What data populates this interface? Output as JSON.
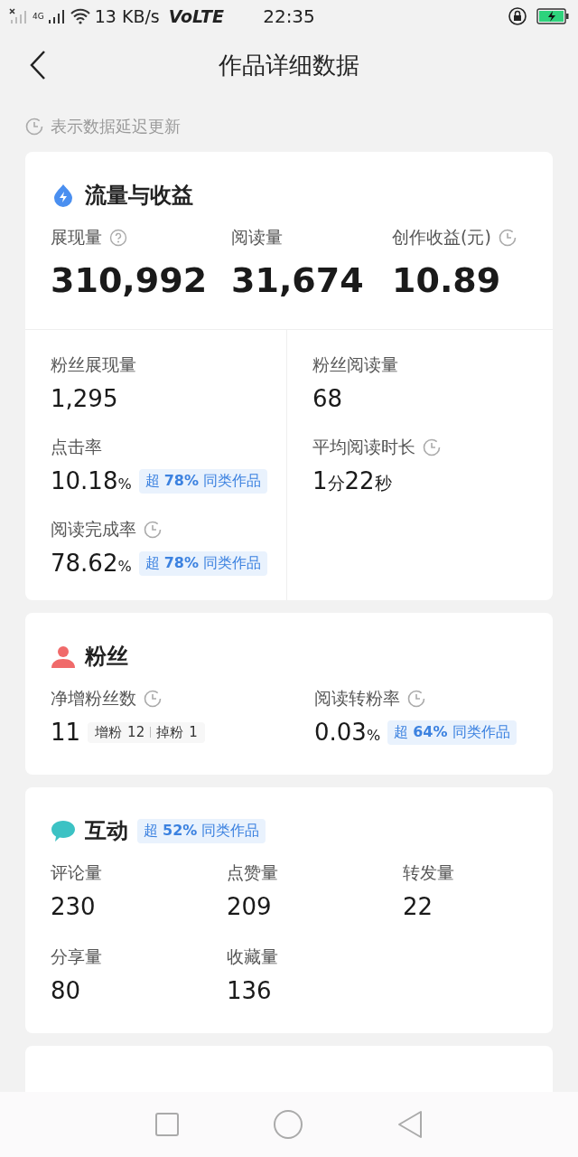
{
  "status_bar": {
    "network": "4G",
    "speed": "13 KB/s",
    "volte": "VoLTE",
    "time": "22:35"
  },
  "header": {
    "title": "作品详细数据"
  },
  "notice": "表示数据延迟更新",
  "sections": [
    {
      "kind": "traffic",
      "title": "流量与收益",
      "metrics": [
        {
          "label": "展现量",
          "has_help": true,
          "parts": [
            {
              "text": "310,992",
              "kind": "number"
            }
          ]
        },
        {
          "label": "阅读量",
          "parts": [
            {
              "text": "31,674",
              "kind": "number"
            }
          ]
        },
        {
          "label": "创作收益(元)",
          "delayed": true,
          "parts": [
            {
              "text": "10.89",
              "kind": "number"
            }
          ]
        }
      ],
      "columns": [
        [
          {
            "label": "粉丝展现量",
            "parts": [
              {
                "text": "1,295",
                "kind": "number"
              }
            ]
          },
          {
            "label": "点击率",
            "parts": [
              {
                "text": "10.18",
                "kind": "number"
              },
              {
                "text": "%",
                "kind": "unit"
              }
            ],
            "badge": "超 **78%** 同类作品"
          },
          {
            "label": "阅读完成率",
            "delayed": true,
            "parts": [
              {
                "text": "78.62",
                "kind": "number"
              },
              {
                "text": "%",
                "kind": "unit"
              }
            ],
            "badge": "超 **78%** 同类作品"
          }
        ],
        [
          {
            "label": "粉丝阅读量",
            "parts": [
              {
                "text": "68",
                "kind": "number"
              }
            ]
          },
          {
            "label": "平均阅读时长",
            "delayed": true,
            "parts": [
              {
                "text": "1",
                "kind": "number"
              },
              {
                "text": "分",
                "kind": "unit"
              },
              {
                "text": "22",
                "kind": "number"
              },
              {
                "text": "秒",
                "kind": "unit"
              }
            ]
          }
        ]
      ]
    },
    {
      "kind": "fans",
      "title": "粉丝",
      "metrics": [
        {
          "label": "净增粉丝数",
          "delayed": true,
          "parts": [
            {
              "text": "11",
              "kind": "number"
            }
          ],
          "breakdown": [
            {
              "label": "增粉",
              "value": "12"
            },
            {
              "label": "掉粉",
              "value": "1"
            }
          ]
        },
        {
          "label": "阅读转粉率",
          "delayed": true,
          "parts": [
            {
              "text": "0.03",
              "kind": "number"
            },
            {
              "text": "%",
              "kind": "unit"
            }
          ],
          "badge": "超 **64%** 同类作品"
        }
      ]
    },
    {
      "kind": "interaction",
      "title": "互动",
      "badge": "超 **52%** 同类作品",
      "metrics": [
        {
          "label": "评论量",
          "parts": [
            {
              "text": "230",
              "kind": "number"
            }
          ]
        },
        {
          "label": "点赞量",
          "parts": [
            {
              "text": "209",
              "kind": "number"
            }
          ]
        },
        {
          "label": "转发量",
          "parts": [
            {
              "text": "22",
              "kind": "number"
            }
          ]
        },
        {
          "label": "分享量",
          "parts": [
            {
              "text": "80",
              "kind": "number"
            }
          ]
        },
        {
          "label": "收藏量",
          "parts": [
            {
              "text": "136",
              "kind": "number"
            }
          ]
        }
      ]
    }
  ]
}
